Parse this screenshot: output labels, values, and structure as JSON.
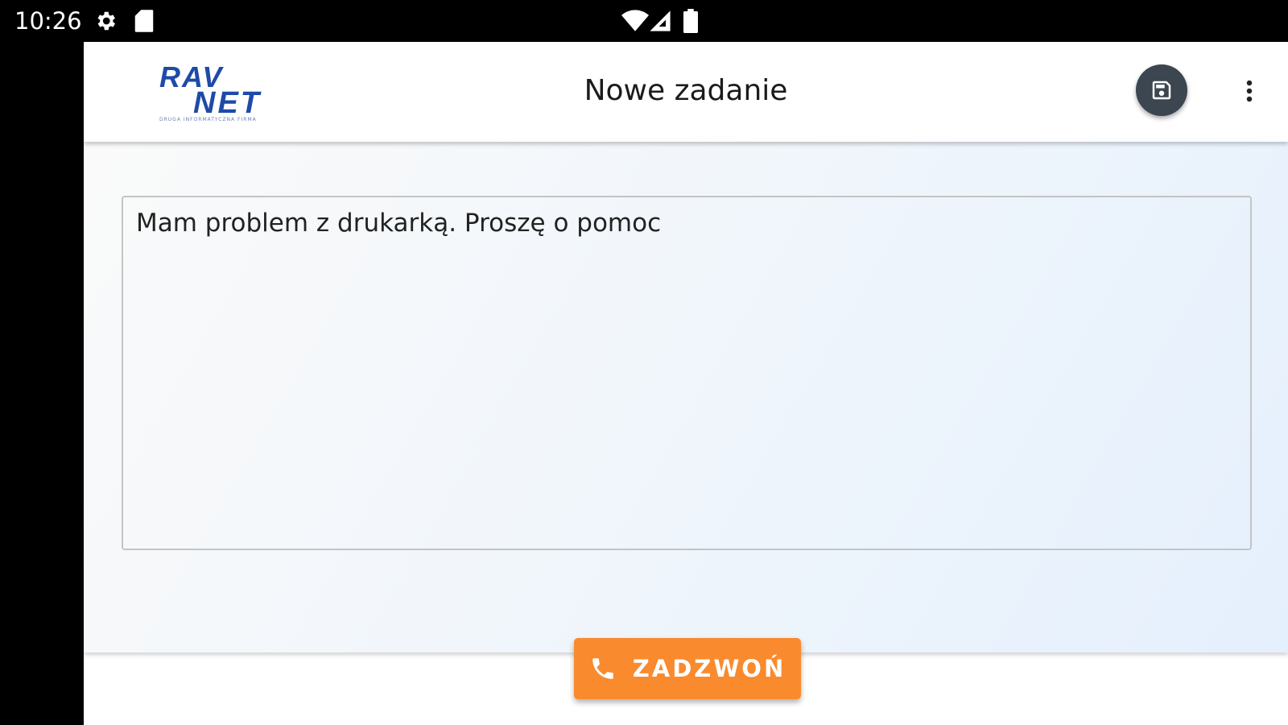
{
  "status_bar": {
    "time": "10:26",
    "icons": [
      "settings-gear-icon",
      "sd-card-icon",
      "wifi-icon",
      "signal-icon",
      "battery-icon"
    ]
  },
  "app_bar": {
    "logo_text_line1": "RAV",
    "logo_text_line2": "NET",
    "logo_tagline": "DRUGA INFORMATYCZNA FIRMA",
    "title": "Nowe zadanie",
    "save_icon": "save-icon",
    "more_icon": "more-vert-icon"
  },
  "form": {
    "description_value": "Mam problem z drukarką. Proszę o pomoc"
  },
  "call_button": {
    "label": "ZADZWOŃ",
    "icon": "phone-icon"
  },
  "colors": {
    "accent": "#fa8a2e",
    "save_button": "#3b4650",
    "logo_blue": "#1e4aa8"
  }
}
